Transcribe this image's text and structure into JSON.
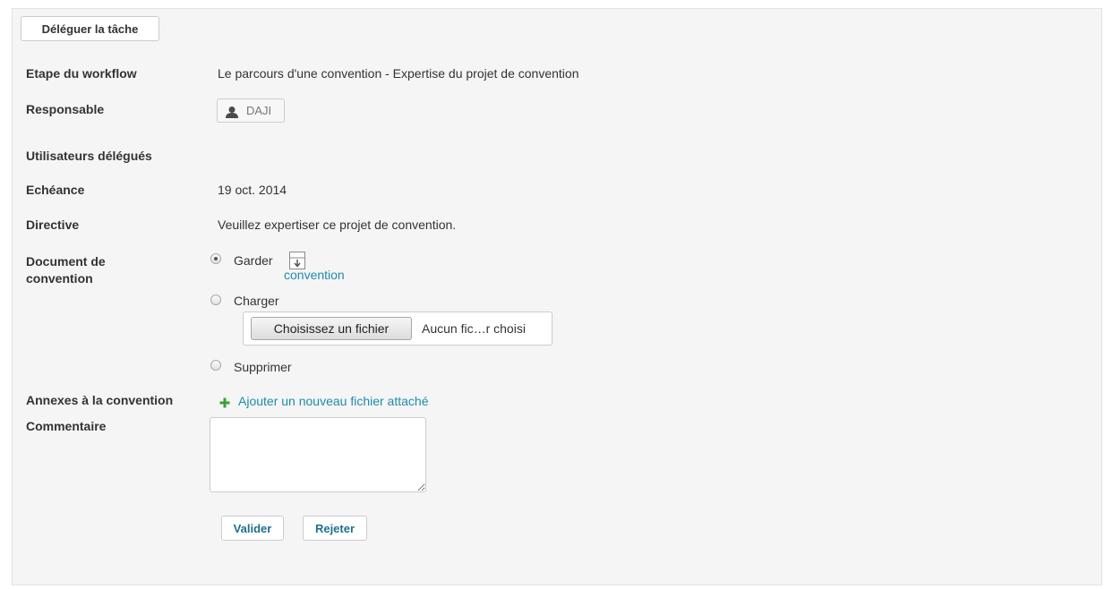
{
  "header": {
    "delegate_label": "Déléguer la tâche"
  },
  "fields": {
    "workflow_step": {
      "label": "Etape du workflow",
      "value": "Le parcours d'une convention - Expertise du projet de convention"
    },
    "responsible": {
      "label": "Responsable",
      "value": "DAJI"
    },
    "delegated_users": {
      "label": "Utilisateurs délégués"
    },
    "due_date": {
      "label": "Echéance",
      "value": "19 oct. 2014"
    },
    "directive": {
      "label": "Directive",
      "value": "Veuillez expertiser ce projet de convention."
    },
    "document": {
      "label_line1": "Document de",
      "label_line2": "convention",
      "options": {
        "keep": "Garder",
        "upload": "Charger",
        "delete": "Supprimer"
      },
      "selected": "keep",
      "file_link": "convention",
      "file_button": "Choisissez un fichier",
      "file_status": "Aucun fic…r choisi"
    },
    "annexes": {
      "label": "Annexes à la convention",
      "add_link": "Ajouter un nouveau fichier attaché"
    },
    "comment": {
      "label": "Commentaire",
      "value": ""
    }
  },
  "actions": {
    "validate_label": "Valider",
    "reject_label": "Rejeter"
  },
  "icons": {
    "user": "user-icon",
    "download": "download-icon",
    "add": "plus-icon"
  },
  "colors": {
    "panel_bg": "#f5f5f5",
    "link": "#1f8bab",
    "button_text": "#1f6f8b",
    "add_icon": "#3aa13a"
  }
}
